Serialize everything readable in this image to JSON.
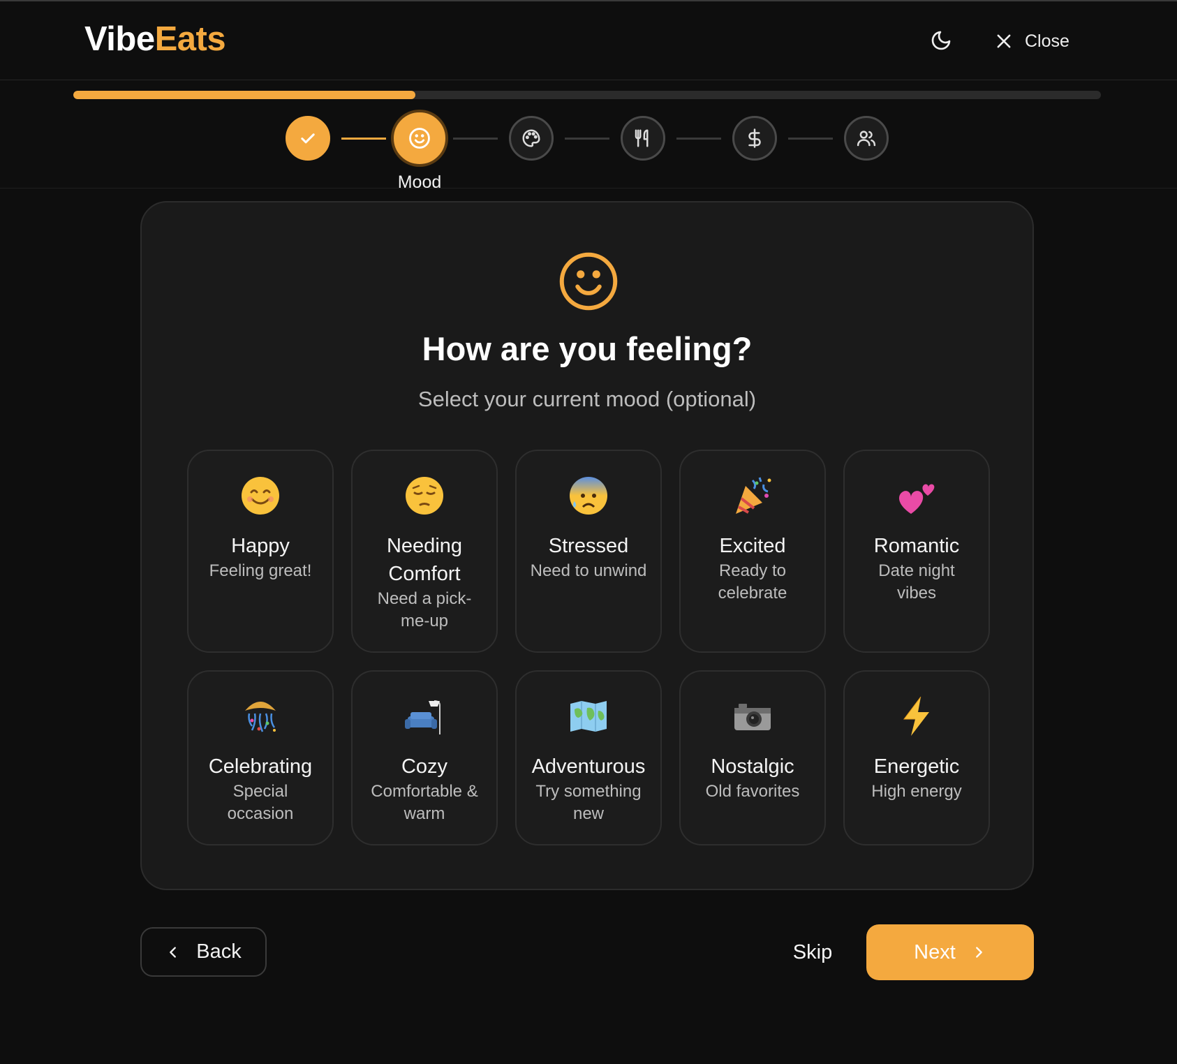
{
  "app": {
    "logo_part1": "Vibe",
    "logo_part2": "Eats"
  },
  "header": {
    "close_label": "Close",
    "theme_icon": "moon-icon",
    "close_icon": "close-icon"
  },
  "progress": {
    "fraction": 0.333
  },
  "steps": [
    {
      "icon": "check-icon",
      "state": "done"
    },
    {
      "icon": "smile-icon",
      "state": "active",
      "label": "Mood"
    },
    {
      "icon": "palette-icon",
      "state": "pending"
    },
    {
      "icon": "utensils-icon",
      "state": "pending"
    },
    {
      "icon": "dollar-icon",
      "state": "pending"
    },
    {
      "icon": "users-icon",
      "state": "pending"
    }
  ],
  "main": {
    "title": "How are you feeling?",
    "subtitle": "Select your current mood (optional)"
  },
  "moods": [
    {
      "emoji": "😊",
      "name": "Happy",
      "desc": "Feeling great!"
    },
    {
      "emoji": "😔",
      "name": "Needing Comfort",
      "desc": "Need a pick-me-up"
    },
    {
      "emoji": "😰",
      "name": "Stressed",
      "desc": "Need to unwind"
    },
    {
      "emoji": "🎉",
      "name": "Excited",
      "desc": "Ready to celebrate"
    },
    {
      "emoji": "💕",
      "name": "Romantic",
      "desc": "Date night vibes"
    },
    {
      "emoji": "🎊",
      "name": "Celebrating",
      "desc": "Special occasion"
    },
    {
      "emoji": "🛋️",
      "name": "Cozy",
      "desc": "Comfortable & warm"
    },
    {
      "emoji": "🗺️",
      "name": "Adventurous",
      "desc": "Try something new"
    },
    {
      "emoji": "📷",
      "name": "Nostalgic",
      "desc": "Old favorites"
    },
    {
      "emoji": "⚡",
      "name": "Energetic",
      "desc": "High energy"
    }
  ],
  "footer": {
    "back_label": "Back",
    "skip_label": "Skip",
    "next_label": "Next"
  },
  "colors": {
    "accent": "#f4a93f",
    "background": "#0e0e0e",
    "card": "#1a1a1a"
  }
}
